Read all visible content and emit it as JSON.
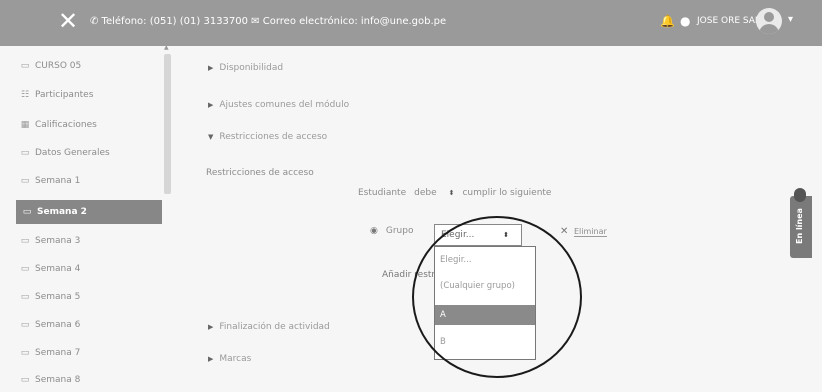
{
  "header": {
    "close_icon": "✕",
    "contact": "✆ Teléfono: (051) (01) 3133700 ✉ Correo electrónico: info@une.gob.pe",
    "user_name": "JOSE ORE SALAN",
    "bell_icon": "bell-icon",
    "chat_icon": "chat-icon"
  },
  "sidebar": {
    "items": [
      {
        "icon": "▭",
        "label": "CURSO 05"
      },
      {
        "icon": "☷",
        "label": "Participantes"
      },
      {
        "icon": "▦",
        "label": "Calificaciones"
      },
      {
        "icon": "▭",
        "label": "Datos Generales"
      },
      {
        "icon": "▭",
        "label": "Semana 1"
      },
      {
        "icon": "▭",
        "label": "Semana 2"
      },
      {
        "icon": "▭",
        "label": "Semana 3"
      },
      {
        "icon": "▭",
        "label": "Semana 4"
      },
      {
        "icon": "▭",
        "label": "Semana 5"
      },
      {
        "icon": "▭",
        "label": "Semana 6"
      },
      {
        "icon": "▭",
        "label": "Semana 7"
      },
      {
        "icon": "▭",
        "label": "Semana 8"
      }
    ],
    "active_index": 5
  },
  "main": {
    "sections": {
      "disponibilidad": "Disponibilidad",
      "ajustes": "Ajustes comunes del módulo",
      "restricciones": "Restricciones de acceso",
      "finalizacion": "Finalización de actividad",
      "marcas": "Marcas"
    },
    "restricciones_label": "Restricciones de acceso",
    "condition": {
      "prefix": "Estudiante",
      "value": "debe",
      "suffix": "cumplir lo siguiente"
    },
    "grupo": {
      "label": "Grupo",
      "selected": "Elegir...",
      "delete_label": "Eliminar",
      "options": [
        "Elegir...",
        "(Cualquier grupo)",
        "A",
        "B"
      ],
      "highlighted_index": 2
    },
    "add_restriction": "Añadir restricción..."
  },
  "online_tab": {
    "label": "En línea"
  },
  "colors": {
    "topbar": "#9a9a9a",
    "active_item": "#878787",
    "annotation_circle": "#1a1a1a"
  }
}
